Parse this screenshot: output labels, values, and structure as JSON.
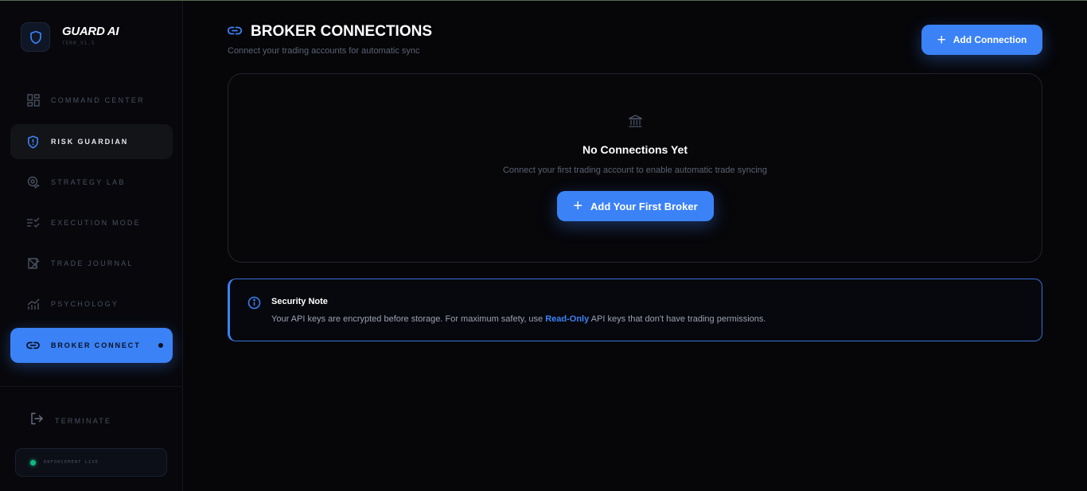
{
  "brand": {
    "name": "GUARD AI",
    "version": "TERM_V1.5"
  },
  "sidebar": {
    "items": [
      {
        "label": "COMMAND CENTER",
        "icon": "dashboard-grid-icon"
      },
      {
        "label": "RISK GUARDIAN",
        "icon": "shield-alert-icon"
      },
      {
        "label": "STRATEGY LAB",
        "icon": "target-gear-icon"
      },
      {
        "label": "EXECUTION MODE",
        "icon": "checklist-icon"
      },
      {
        "label": "TRADE JOURNAL",
        "icon": "journal-icon"
      },
      {
        "label": "PSYCHOLOGY",
        "icon": "chart-bars-icon"
      },
      {
        "label": "BROKER CONNECT",
        "icon": "link-icon"
      }
    ],
    "active_item": "BROKER CONNECT",
    "terminate_label": "TERMINATE",
    "status_label": "ENFORCEMENT LIVE"
  },
  "header": {
    "title": "BROKER CONNECTIONS",
    "subtitle": "Connect your trading accounts for automatic sync",
    "add_button_label": "Add Connection"
  },
  "empty_state": {
    "title": "No Connections Yet",
    "description": "Connect your first trading account to enable automatic trade syncing",
    "button_label": "Add Your First Broker"
  },
  "security_note": {
    "title": "Security Note",
    "text_before": "Your API keys are encrypted before storage. For maximum safety, use ",
    "highlight": "Read-Only",
    "text_after": " API keys that don't have trading permissions."
  },
  "colors": {
    "accent": "#3b82f6",
    "background": "#060609",
    "status_live": "#10b981"
  }
}
